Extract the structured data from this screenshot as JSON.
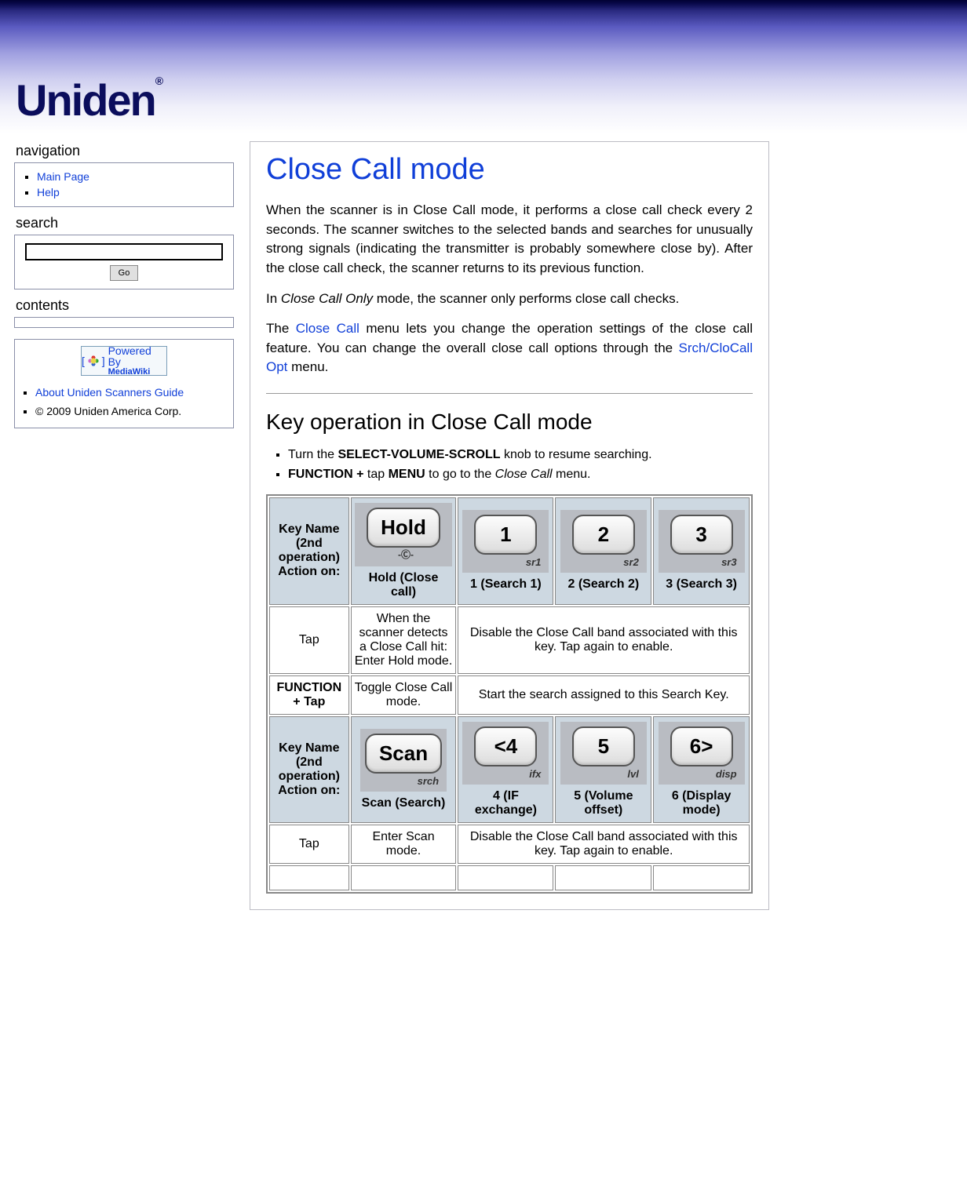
{
  "logo_text": "Uniden",
  "logo_mark": "®",
  "nav": {
    "title": "navigation",
    "items": [
      "Main Page",
      "Help"
    ]
  },
  "search": {
    "title": "search",
    "go_label": "Go"
  },
  "contents": {
    "title": "contents"
  },
  "footer": {
    "badge_top": "Powered By",
    "badge_bottom": "MediaWiki",
    "items": [
      "About Uniden Scanners Guide",
      "© 2009 Uniden America Corp."
    ]
  },
  "page": {
    "title": "Close Call mode",
    "p1": "When the scanner is in Close Call mode, it performs a close call check every 2 seconds. The scanner switches to the selected bands and searches for unusually strong signals (indicating the transmitter is probably somewhere close by). After the close call check, the scanner returns to its previous function.",
    "p2_a": "In ",
    "p2_em": "Close Call Only",
    "p2_b": " mode, the scanner only performs close call checks.",
    "p3_a": "The ",
    "p3_link1": "Close Call",
    "p3_b": " menu lets you change the operation settings of the close call feature. You can change the overall close call options through the ",
    "p3_link2": "Srch/CloCall Opt",
    "p3_c": " menu.",
    "section2": "Key operation in Close Call mode",
    "li1_a": "Turn the ",
    "li1_b": "SELECT-VOLUME-SCROLL",
    "li1_c": " knob to resume searching.",
    "li2_a": "FUNCTION +",
    "li2_b": " tap ",
    "li2_c": "MENU",
    "li2_d": " to go to the ",
    "li2_em": "Close Call",
    "li2_e": " menu."
  },
  "table": {
    "hdr_label": "Key Name (2nd operation) Action on:",
    "row1": {
      "k1": {
        "cap": "Hold",
        "sub": "-Ⓒ-",
        "label": "Hold (Close call)"
      },
      "k2": {
        "cap": "1",
        "sub": "sr1",
        "label": "1 (Search 1)"
      },
      "k3": {
        "cap": "2",
        "sub": "sr2",
        "label": "2 (Search 2)"
      },
      "k4": {
        "cap": "3",
        "sub": "sr3",
        "label": "3 (Search 3)"
      }
    },
    "tap_label": "Tap",
    "tap_c1": "When the scanner detects a Close Call hit: Enter Hold mode.",
    "tap_c234": "Disable the Close Call band associated with this key. Tap again to enable.",
    "ftap_label": "FUNCTION + Tap",
    "ftap_c1": "Toggle Close Call mode.",
    "ftap_c234": "Start the search assigned to this Search Key.",
    "row2": {
      "k1": {
        "cap": "Scan",
        "sub": "srch",
        "label": "Scan (Search)"
      },
      "k2": {
        "cap": "<4",
        "sub": "ifx",
        "label": "4 (IF exchange)"
      },
      "k3": {
        "cap": "5",
        "sub": "lvl",
        "label": "5 (Volume offset)"
      },
      "k4": {
        "cap": "6>",
        "sub": "disp",
        "label": "6 (Display mode)"
      }
    },
    "tap2_c1": "Enter Scan mode.",
    "tap2_c234": "Disable the Close Call band associated with this key. Tap again to enable."
  }
}
